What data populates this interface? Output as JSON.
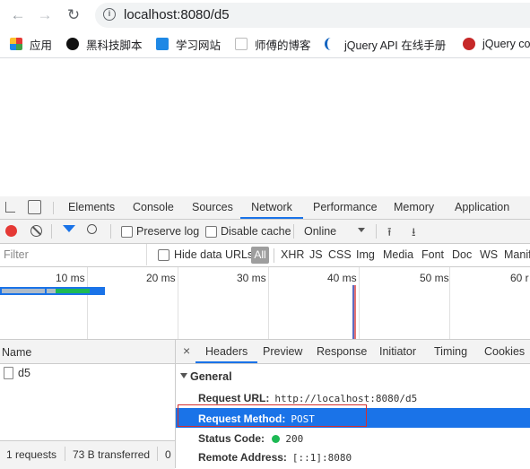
{
  "browser": {
    "url": "localhost:8080/d5",
    "bookmarks": [
      {
        "label": "应用",
        "color": "#e53935"
      },
      {
        "label": "黑科技脚本",
        "color": "#111111"
      },
      {
        "label": "学习网站",
        "color": "#1e88e5"
      },
      {
        "label": "师傅的博客",
        "color": "#9e9e9e"
      },
      {
        "label": "jQuery API 在线手册",
        "color": "#1565c0"
      },
      {
        "label": "jQuery co",
        "color": "#c62828"
      }
    ]
  },
  "devtools": {
    "tabs": [
      "Elements",
      "Console",
      "Sources",
      "Network",
      "Performance",
      "Memory",
      "Application"
    ],
    "active_tab": "Network",
    "toolbar": {
      "preserve_log": "Preserve log",
      "disable_cache": "Disable cache",
      "throttle": "Online"
    },
    "filter": {
      "placeholder": "Filter",
      "hide_data_urls": "Hide data URLs",
      "types": [
        "All",
        "XHR",
        "JS",
        "CSS",
        "Img",
        "Media",
        "Font",
        "Doc",
        "WS",
        "Manif"
      ]
    },
    "timeline_ticks": [
      "10 ms",
      "20 ms",
      "30 ms",
      "40 ms",
      "50 ms",
      "60 r"
    ],
    "requests": {
      "header": "Name",
      "items": [
        "d5"
      ],
      "summary": [
        "1 requests",
        "73 B transferred",
        "0"
      ]
    },
    "detail": {
      "tabs": [
        "Headers",
        "Preview",
        "Response",
        "Initiator",
        "Timing",
        "Cookies"
      ],
      "active_tab": "Headers",
      "section": "General",
      "fields": [
        {
          "key": "Request URL:",
          "value": "http://localhost:8080/d5"
        },
        {
          "key": "Request Method:",
          "value": "POST"
        },
        {
          "key": "Status Code:",
          "value": "200"
        },
        {
          "key": "Remote Address:",
          "value": "[::1]:8080"
        }
      ]
    }
  }
}
